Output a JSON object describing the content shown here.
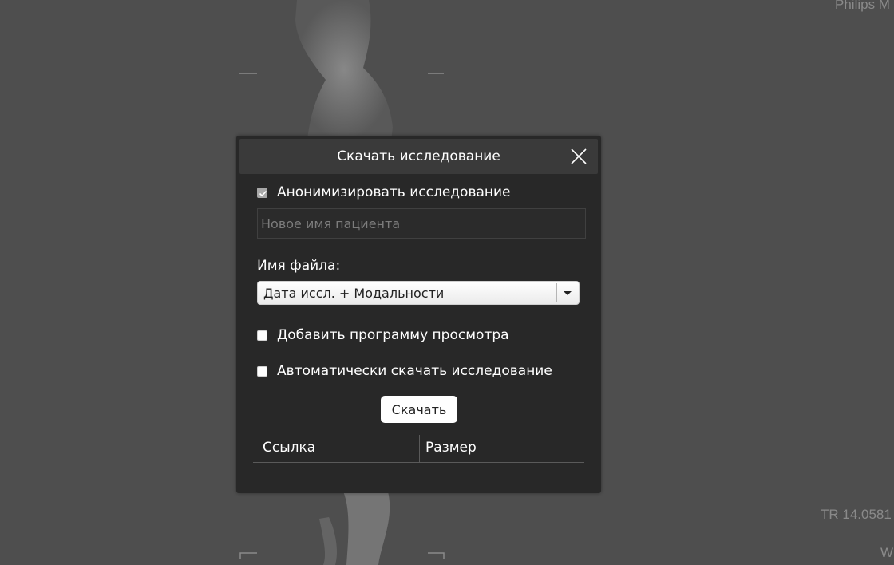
{
  "viewer": {
    "overlay": {
      "manufacturer": "Philips M",
      "tr": "TR 14.0581",
      "w": "W"
    }
  },
  "dialog": {
    "title": "Скачать исследование",
    "anonymize": {
      "label": "Анонимизировать исследование",
      "checked": true
    },
    "patient_name": {
      "placeholder": "Новое имя пациента",
      "value": ""
    },
    "filename": {
      "label": "Имя файла:",
      "selected": "Дата иссл. + Модальности"
    },
    "add_viewer": {
      "label": "Добавить программу просмотра",
      "checked": false
    },
    "auto_download": {
      "label": "Автоматически скачать исследование",
      "checked": false
    },
    "download_button": "Скачать",
    "table": {
      "columns": [
        "Ссылка",
        "Размер"
      ],
      "rows": []
    }
  },
  "colors": {
    "viewer_background": "#4e4e4e",
    "dialog_background": "#282828",
    "dialog_header": "#3a3a3a",
    "text": "#ffffff"
  }
}
